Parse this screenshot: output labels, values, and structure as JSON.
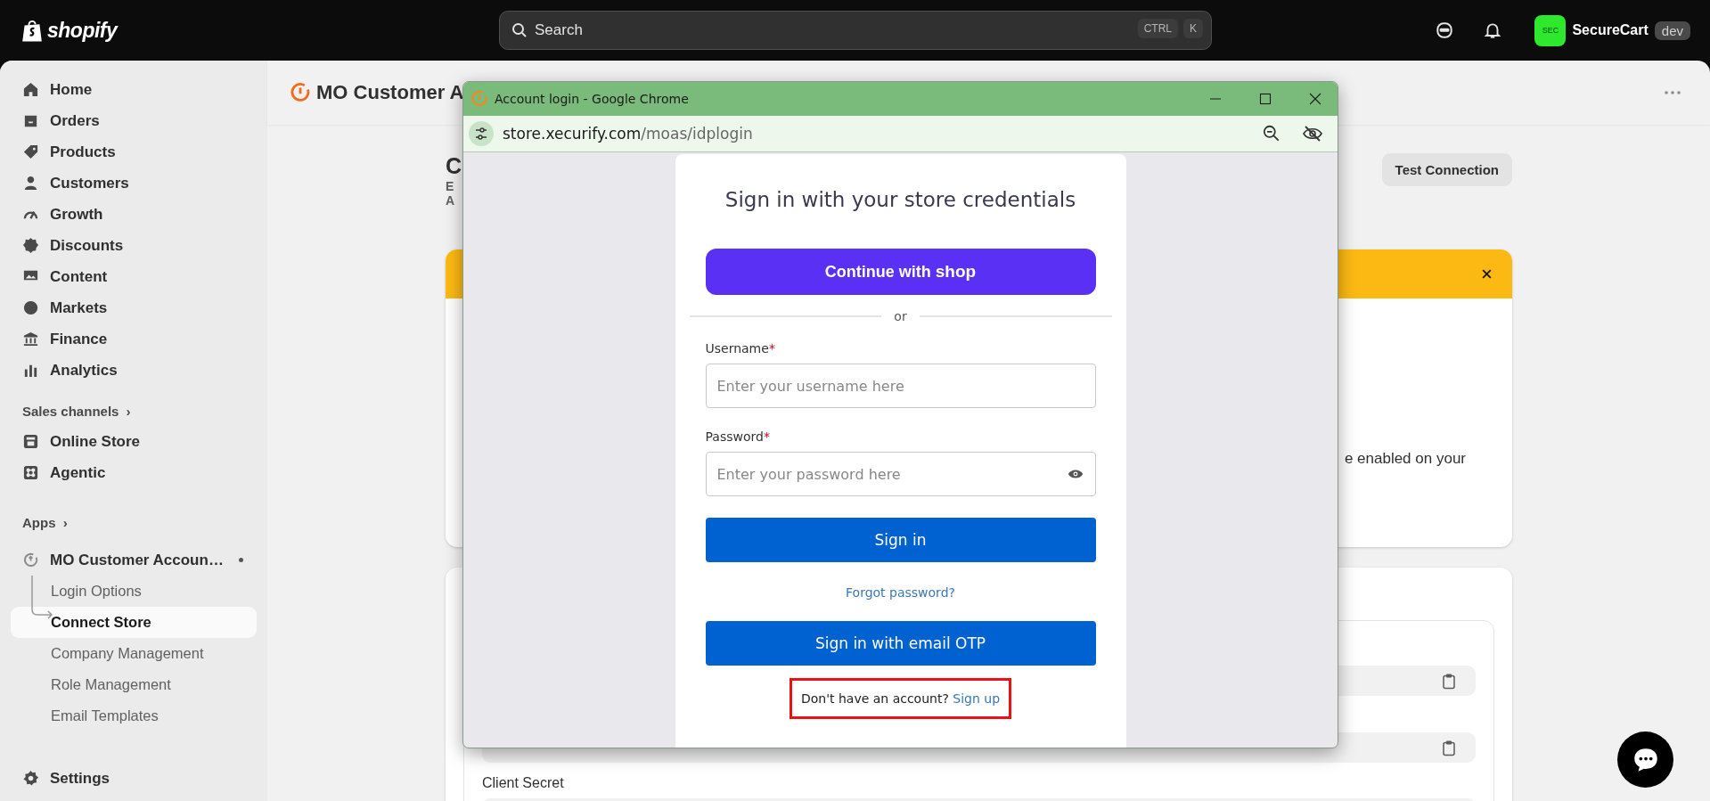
{
  "topbar": {
    "logo": "shopify",
    "search": {
      "placeholder": "Search",
      "keys": [
        "CTRL",
        "K"
      ]
    },
    "store": {
      "avatar": "SEC",
      "name": "SecureCart",
      "badge": "dev"
    }
  },
  "sidebar": {
    "items": [
      {
        "label": "Home"
      },
      {
        "label": "Orders"
      },
      {
        "label": "Products"
      },
      {
        "label": "Customers"
      },
      {
        "label": "Growth"
      },
      {
        "label": "Discounts"
      },
      {
        "label": "Content"
      },
      {
        "label": "Markets"
      },
      {
        "label": "Finance"
      },
      {
        "label": "Analytics"
      }
    ],
    "sales_channels": {
      "heading": "Sales channels",
      "chevron": "›",
      "items": [
        {
          "label": "Online Store"
        },
        {
          "label": "Agentic"
        }
      ]
    },
    "apps": {
      "heading": "Apps",
      "chevron": "›",
      "app": {
        "label": "MO Customer Accoun…",
        "children": [
          {
            "label": "Login Options",
            "selected": false
          },
          {
            "label": "Connect Store",
            "selected": true
          },
          {
            "label": "Company Management",
            "selected": false
          },
          {
            "label": "Role Management",
            "selected": false
          },
          {
            "label": "Email Templates",
            "selected": false
          }
        ]
      }
    },
    "settings": {
      "label": "Settings"
    }
  },
  "page": {
    "title": "MO Customer A",
    "section": {
      "heading": "C",
      "lines": [
        "E",
        "A"
      ],
      "button": "Test Connection"
    },
    "banner": {
      "text": "e enabled on your"
    },
    "credentials": {
      "label": "Client Secret"
    }
  },
  "popup": {
    "title": "Account login - Google Chrome",
    "url": {
      "host": "store.xecurify.com",
      "path": "/moas/idplogin"
    },
    "form": {
      "heading": "Sign in with your store credentials",
      "shop_button": {
        "text": "Continue with",
        "brand": "shop"
      },
      "divider": "or",
      "fields": [
        {
          "label": "Username",
          "required_mark": "*",
          "placeholder": "Enter your username here",
          "kind": "text"
        },
        {
          "label": "Password",
          "required_mark": "*",
          "placeholder": "Enter your password here",
          "kind": "password"
        }
      ],
      "sign_in": "Sign in",
      "forgot": "Forgot password?",
      "otp": "Sign in with email OTP",
      "signup": {
        "prompt": "Don't have an account?",
        "link": "Sign up",
        "highlighted": true
      }
    }
  }
}
